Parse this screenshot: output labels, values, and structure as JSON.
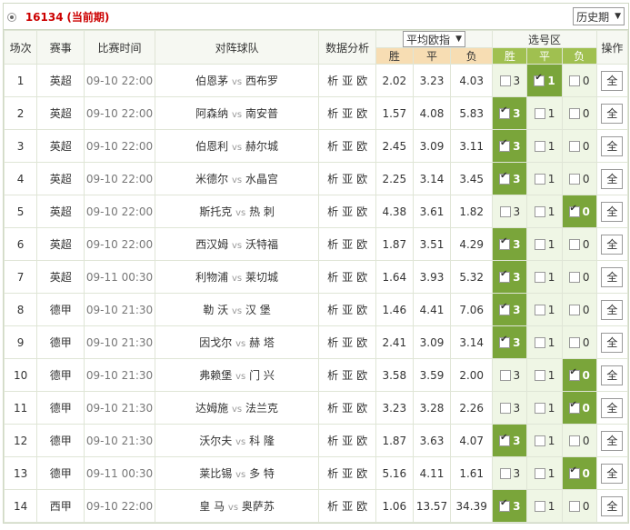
{
  "header": {
    "issue": "16134",
    "issue_suffix": "(当前期)",
    "history_label": "历史期"
  },
  "table": {
    "headers": [
      "场次",
      "赛事",
      "比赛时间",
      "对阵球队",
      "数据分析",
      "平均欧指",
      "选号区",
      "操作"
    ],
    "sub": [
      "胜",
      "平",
      "负",
      "胜",
      "平",
      "负"
    ],
    "analysis": [
      "析",
      "亚",
      "欧"
    ],
    "rows": [
      {
        "no": "1",
        "league": "英超",
        "time": "09-10 22:00",
        "home": "伯恩茅",
        "away": "西布罗",
        "w": "2.02",
        "d": "3.23",
        "l": "4.03",
        "pick": "d"
      },
      {
        "no": "2",
        "league": "英超",
        "time": "09-10 22:00",
        "home": "阿森纳",
        "away": "南安普",
        "w": "1.57",
        "d": "4.08",
        "l": "5.83",
        "pick": "w"
      },
      {
        "no": "3",
        "league": "英超",
        "time": "09-10 22:00",
        "home": "伯恩利",
        "away": "赫尔城",
        "w": "2.45",
        "d": "3.09",
        "l": "3.11",
        "pick": "w"
      },
      {
        "no": "4",
        "league": "英超",
        "time": "09-10 22:00",
        "home": "米德尔",
        "away": "水晶宫",
        "w": "2.25",
        "d": "3.14",
        "l": "3.45",
        "pick": "w"
      },
      {
        "no": "5",
        "league": "英超",
        "time": "09-10 22:00",
        "home": "斯托克",
        "away": "热 刺",
        "w": "4.38",
        "d": "3.61",
        "l": "1.82",
        "pick": "l"
      },
      {
        "no": "6",
        "league": "英超",
        "time": "09-10 22:00",
        "home": "西汉姆",
        "away": "沃特福",
        "w": "1.87",
        "d": "3.51",
        "l": "4.29",
        "pick": "w"
      },
      {
        "no": "7",
        "league": "英超",
        "time": "09-11 00:30",
        "home": "利物浦",
        "away": "莱切城",
        "w": "1.64",
        "d": "3.93",
        "l": "5.32",
        "pick": "w"
      },
      {
        "no": "8",
        "league": "德甲",
        "time": "09-10 21:30",
        "home": "勒 沃",
        "away": "汉 堡",
        "w": "1.46",
        "d": "4.41",
        "l": "7.06",
        "pick": "w"
      },
      {
        "no": "9",
        "league": "德甲",
        "time": "09-10 21:30",
        "home": "因戈尔",
        "away": "赫 塔",
        "w": "2.41",
        "d": "3.09",
        "l": "3.14",
        "pick": "w"
      },
      {
        "no": "10",
        "league": "德甲",
        "time": "09-10 21:30",
        "home": "弗赖堡",
        "away": "门 兴",
        "w": "3.58",
        "d": "3.59",
        "l": "2.00",
        "pick": "l"
      },
      {
        "no": "11",
        "league": "德甲",
        "time": "09-10 21:30",
        "home": "达姆施",
        "away": "法兰克",
        "w": "3.23",
        "d": "3.28",
        "l": "2.26",
        "pick": "l"
      },
      {
        "no": "12",
        "league": "德甲",
        "time": "09-10 21:30",
        "home": "沃尔夫",
        "away": "科 隆",
        "w": "1.87",
        "d": "3.63",
        "l": "4.07",
        "pick": "w"
      },
      {
        "no": "13",
        "league": "德甲",
        "time": "09-11 00:30",
        "home": "莱比锡",
        "away": "多 特",
        "w": "5.16",
        "d": "4.11",
        "l": "1.61",
        "pick": "l"
      },
      {
        "no": "14",
        "league": "西甲",
        "time": "09-10 22:00",
        "home": "皇 马",
        "away": "奥萨苏",
        "w": "1.06",
        "d": "13.57",
        "l": "34.39",
        "pick": "w"
      }
    ],
    "pick_values": {
      "w": "3",
      "d": "1",
      "l": "0"
    },
    "vs": "vs",
    "action": "全"
  }
}
